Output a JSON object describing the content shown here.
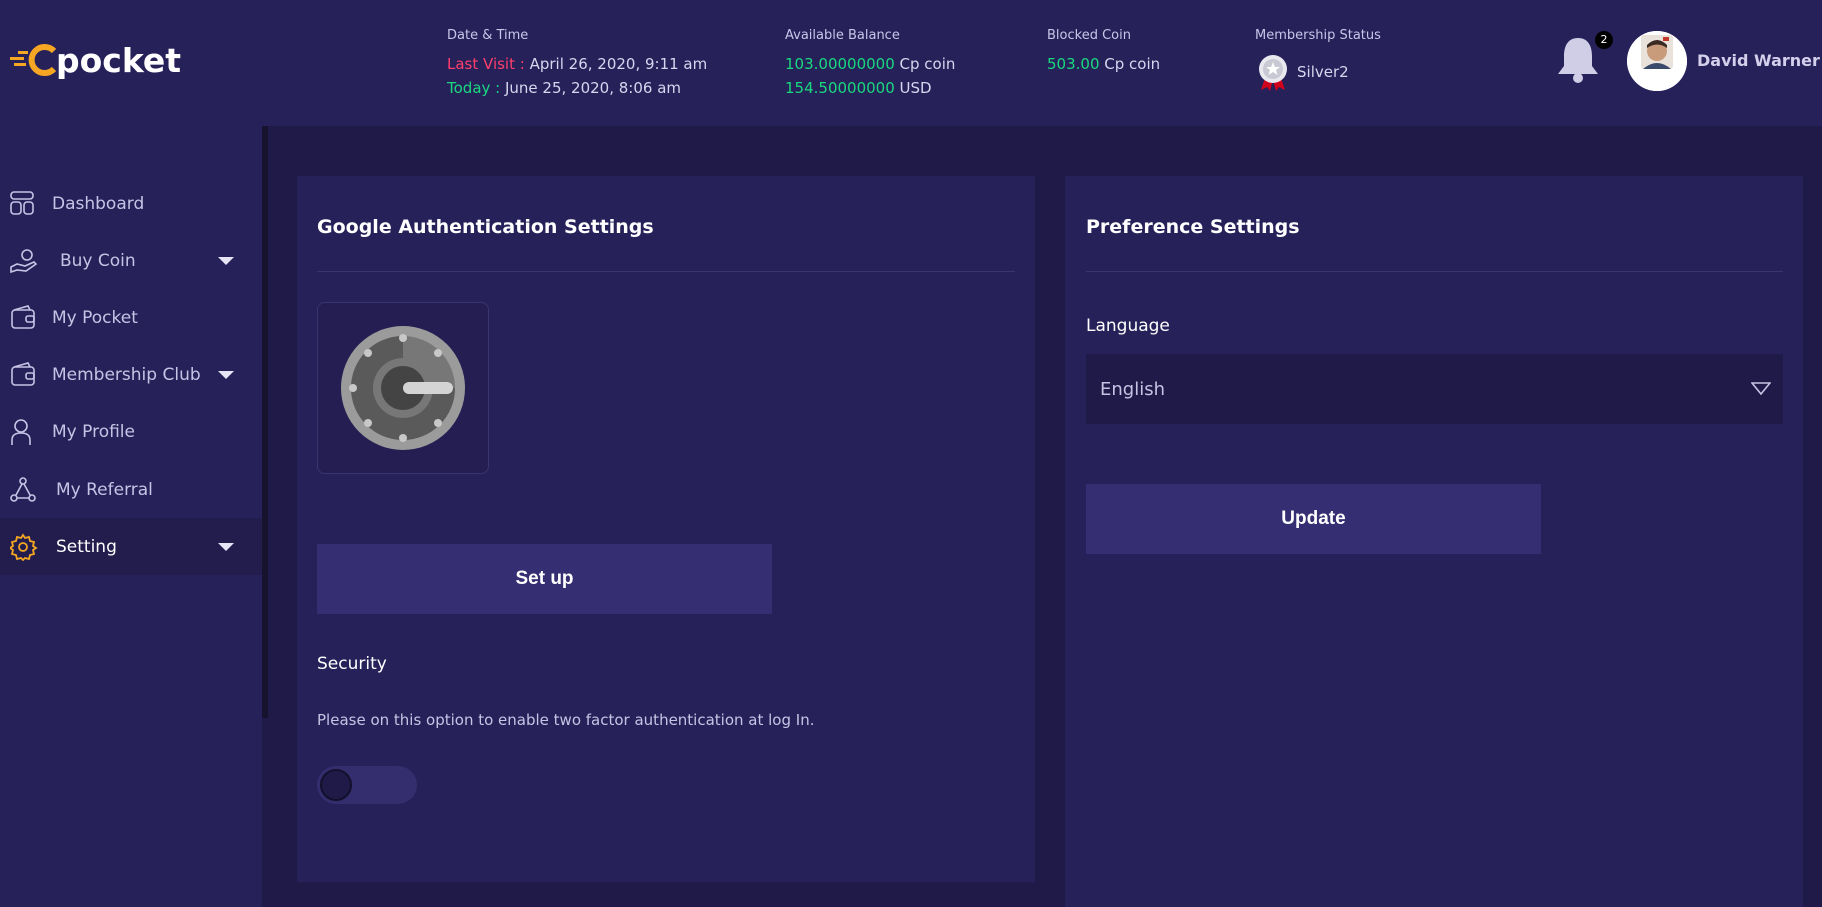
{
  "brand": {
    "logo_text": "pocket",
    "colors": {
      "accent": "#f5a623",
      "red": "#ff3f6b",
      "green": "#19d97f"
    }
  },
  "header": {
    "datetime": {
      "label": "Date & Time",
      "last_visit_label": "Last Visit :",
      "last_visit_value": "April 26, 2020, 9:11 am",
      "today_label": "Today :",
      "today_value": "June 25, 2020, 8:06 am"
    },
    "balance": {
      "label": "Available Balance",
      "cp_amount": "103.00000000",
      "cp_unit": "Cp coin",
      "usd_amount": "154.50000000",
      "usd_unit": "USD"
    },
    "blocked": {
      "label": "Blocked Coin",
      "amount": "503.00",
      "unit": "Cp coin"
    },
    "membership": {
      "label": "Membership Status",
      "value": "Silver2"
    },
    "notifications": {
      "count": "2",
      "icon": "bell-icon"
    },
    "user": {
      "name": "David Warner"
    }
  },
  "sidebar": {
    "items": [
      {
        "label": "Dashboard",
        "icon": "dashboard-icon"
      },
      {
        "label": "Buy Coin",
        "icon": "buy-coin-icon"
      },
      {
        "label": "My Pocket",
        "icon": "wallet-icon"
      },
      {
        "label": "Membership Club",
        "icon": "membership-icon"
      },
      {
        "label": "My Profile",
        "icon": "user-icon"
      },
      {
        "label": "My Referral",
        "icon": "referral-icon"
      },
      {
        "label": "Setting",
        "icon": "gear-icon"
      }
    ]
  },
  "google_auth": {
    "title": "Google Authentication Settings",
    "setup_label": "Set up",
    "security_label": "Security",
    "security_desc": "Please on this option to enable two factor authentication at log In.",
    "toggle_on": false
  },
  "preferences": {
    "title": "Preference Settings",
    "language_label": "Language",
    "language_value": "English",
    "update_label": "Update"
  }
}
